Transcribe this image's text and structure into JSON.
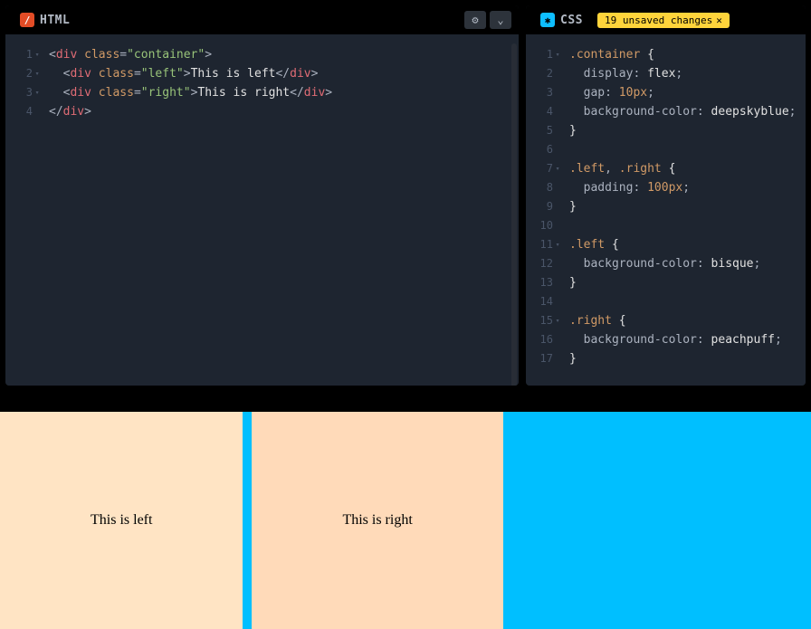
{
  "panels": {
    "html": {
      "label": "HTML",
      "code_lines": [
        {
          "num": "1",
          "fold": true,
          "html": "<span class='tok-punct'>&lt;</span><span class='tok-tag'>div</span> <span class='tok-attr'>class</span><span class='tok-punct'>=</span><span class='tok-string'>\"container\"</span><span class='tok-punct'>&gt;</span>"
        },
        {
          "num": "2",
          "fold": true,
          "html": "  <span class='tok-punct'>&lt;</span><span class='tok-tag'>div</span> <span class='tok-attr'>class</span><span class='tok-punct'>=</span><span class='tok-string'>\"left\"</span><span class='tok-punct'>&gt;</span><span class='tok-text'>This is left</span><span class='tok-punct'>&lt;/</span><span class='tok-tag'>div</span><span class='tok-punct'>&gt;</span>"
        },
        {
          "num": "3",
          "fold": true,
          "html": "  <span class='tok-punct'>&lt;</span><span class='tok-tag'>div</span> <span class='tok-attr'>class</span><span class='tok-punct'>=</span><span class='tok-string'>\"right\"</span><span class='tok-punct'>&gt;</span><span class='tok-text'>This is right</span><span class='tok-punct'>&lt;/</span><span class='tok-tag'>div</span><span class='tok-punct'>&gt;</span>"
        },
        {
          "num": "4",
          "fold": false,
          "html": "<span class='tok-punct'>&lt;/</span><span class='tok-tag'>div</span><span class='tok-punct'>&gt;</span>"
        }
      ]
    },
    "css": {
      "label": "CSS",
      "unsaved_badge": "19 unsaved changes",
      "code_lines": [
        {
          "num": "1",
          "fold": true,
          "html": "<span class='tok-selector'>.container</span> <span class='tok-brace'>{</span>"
        },
        {
          "num": "2",
          "fold": false,
          "html": "  <span class='tok-prop'>display</span><span class='tok-punct'>:</span> <span class='tok-keyword'>flex</span><span class='tok-punct'>;</span>"
        },
        {
          "num": "3",
          "fold": false,
          "html": "  <span class='tok-prop'>gap</span><span class='tok-punct'>:</span> <span class='tok-value'>10px</span><span class='tok-punct'>;</span>"
        },
        {
          "num": "4",
          "fold": false,
          "html": "  <span class='tok-prop'>background-color</span><span class='tok-punct'>:</span> <span class='tok-keyword'>deepskyblue</span><span class='tok-punct'>;</span>"
        },
        {
          "num": "5",
          "fold": false,
          "html": "<span class='tok-brace'>}</span>"
        },
        {
          "num": "6",
          "fold": false,
          "html": ""
        },
        {
          "num": "7",
          "fold": true,
          "html": "<span class='tok-selector'>.left</span><span class='tok-punct'>,</span> <span class='tok-selector'>.right</span> <span class='tok-brace'>{</span>"
        },
        {
          "num": "8",
          "fold": false,
          "html": "  <span class='tok-prop'>padding</span><span class='tok-punct'>:</span> <span class='tok-value'>100px</span><span class='tok-punct'>;</span>"
        },
        {
          "num": "9",
          "fold": false,
          "html": "<span class='tok-brace'>}</span>"
        },
        {
          "num": "10",
          "fold": false,
          "html": ""
        },
        {
          "num": "11",
          "fold": true,
          "html": "<span class='tok-selector'>.left</span> <span class='tok-brace'>{</span>"
        },
        {
          "num": "12",
          "fold": false,
          "html": "  <span class='tok-prop'>background-color</span><span class='tok-punct'>:</span> <span class='tok-keyword'>bisque</span><span class='tok-punct'>;</span>"
        },
        {
          "num": "13",
          "fold": false,
          "html": "<span class='tok-brace'>}</span>"
        },
        {
          "num": "14",
          "fold": false,
          "html": ""
        },
        {
          "num": "15",
          "fold": true,
          "html": "<span class='tok-selector'>.right</span> <span class='tok-brace'>{</span>"
        },
        {
          "num": "16",
          "fold": false,
          "html": "  <span class='tok-prop'>background-color</span><span class='tok-punct'>:</span> <span class='tok-keyword'>peachpuff</span><span class='tok-punct'>;</span>"
        },
        {
          "num": "17",
          "fold": false,
          "html": "<span class='tok-brace'>}</span>"
        }
      ]
    }
  },
  "preview": {
    "left_text": "This is left",
    "right_text": "This is right"
  },
  "icons": {
    "gear": "⚙",
    "chevron_down": "⌄",
    "close": "✕",
    "asterisk": "✱"
  }
}
